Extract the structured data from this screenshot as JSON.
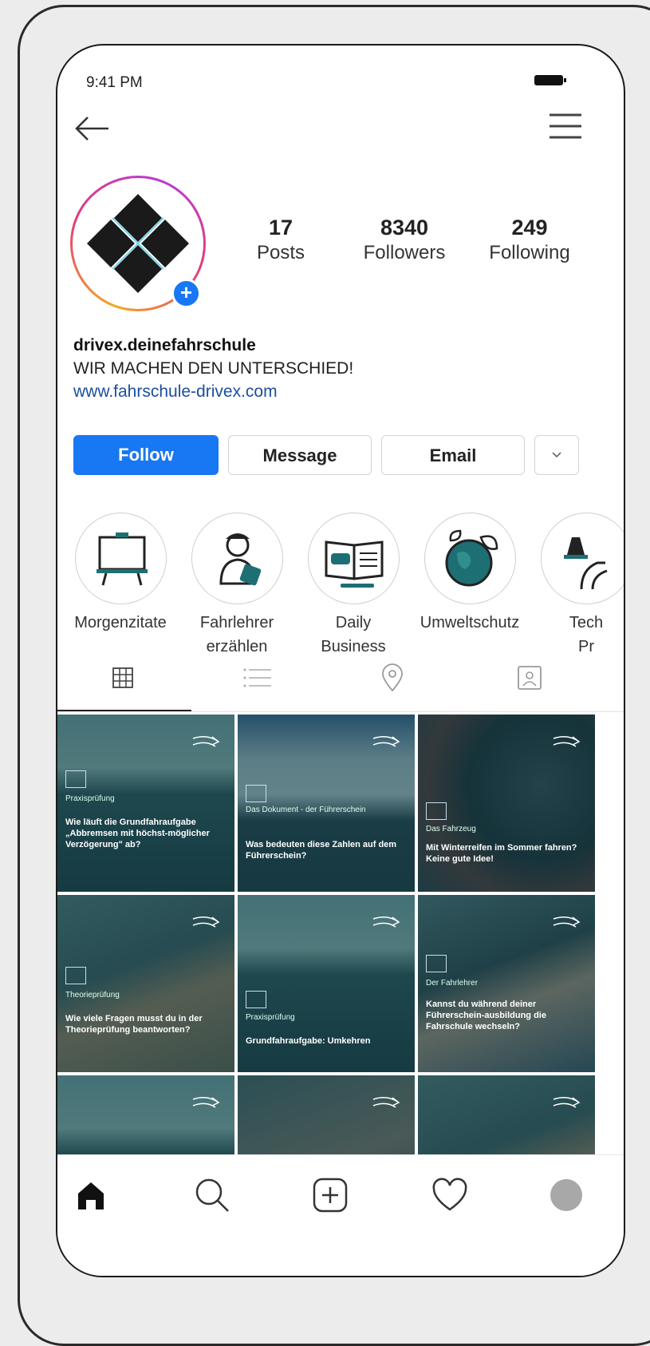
{
  "status_bar": {
    "time": "9:41 PM"
  },
  "header": {
    "back_icon": "back-arrow-icon",
    "menu_icon": "hamburger-menu-icon"
  },
  "profile": {
    "username": "drivex.deinefahrschule",
    "bio": "WIR MACHEN DEN UNTERSCHIED!",
    "link": "www.fahrschule-drivex.com"
  },
  "stats": [
    {
      "value": "17",
      "label": "Posts"
    },
    {
      "value": "8340",
      "label": "Followers"
    },
    {
      "value": "249",
      "label": "Following"
    }
  ],
  "actions": {
    "follow": "Follow",
    "message": "Message",
    "email": "Email",
    "more": "⌄"
  },
  "highlights": [
    {
      "line1": "Morgenzitate",
      "line2": "",
      "icon": "easel-board-icon"
    },
    {
      "line1": "Fahrlehrer",
      "line2": "erzählen",
      "icon": "instructor-icon"
    },
    {
      "line1": "Daily",
      "line2": "Business",
      "icon": "open-book-car-icon"
    },
    {
      "line1": "Umweltschutz",
      "line2": "",
      "icon": "earth-leaf-icon"
    },
    {
      "line1": "Tech",
      "line2": "Pr",
      "icon": "traffic-cone-icon"
    }
  ],
  "tabs": [
    "grid-icon",
    "list-icon",
    "location-pin-icon",
    "tagged-person-icon"
  ],
  "posts": [
    {
      "tag": "Praxisprüfung",
      "title": "Wie läuft die Grundfahraufgabe „Abbremsen mit höchst-möglicher Verzögerung\" ab?"
    },
    {
      "tag": "Das Dokument - der Führerschein",
      "title": "Was bedeuten diese Zahlen auf dem Führerschein?"
    },
    {
      "tag": "Das Fahrzeug",
      "title": "Mit Winterreifen im Sommer fahren? Keine gute Idee!"
    },
    {
      "tag": "Theorieprüfung",
      "title": "Wie viele Fragen musst du in der Theorieprüfung beantworten?"
    },
    {
      "tag": "Praxisprüfung",
      "title": "Grundfahraufgabe: Umkehren"
    },
    {
      "tag": "Der Fahrlehrer",
      "title": "Kannst du während deiner Führerschein-ausbildung die Fahrschule wechseln?"
    },
    {
      "tag": "",
      "title": ""
    },
    {
      "tag": "",
      "title": ""
    },
    {
      "tag": "",
      "title": ""
    }
  ],
  "bottom_nav": [
    "home-icon",
    "search-icon",
    "add-post-icon",
    "heart-icon",
    "profile-avatar-icon"
  ],
  "colors": {
    "accent": "#1877f2",
    "link": "#1b4ea0",
    "tile_tint": "#124650"
  }
}
